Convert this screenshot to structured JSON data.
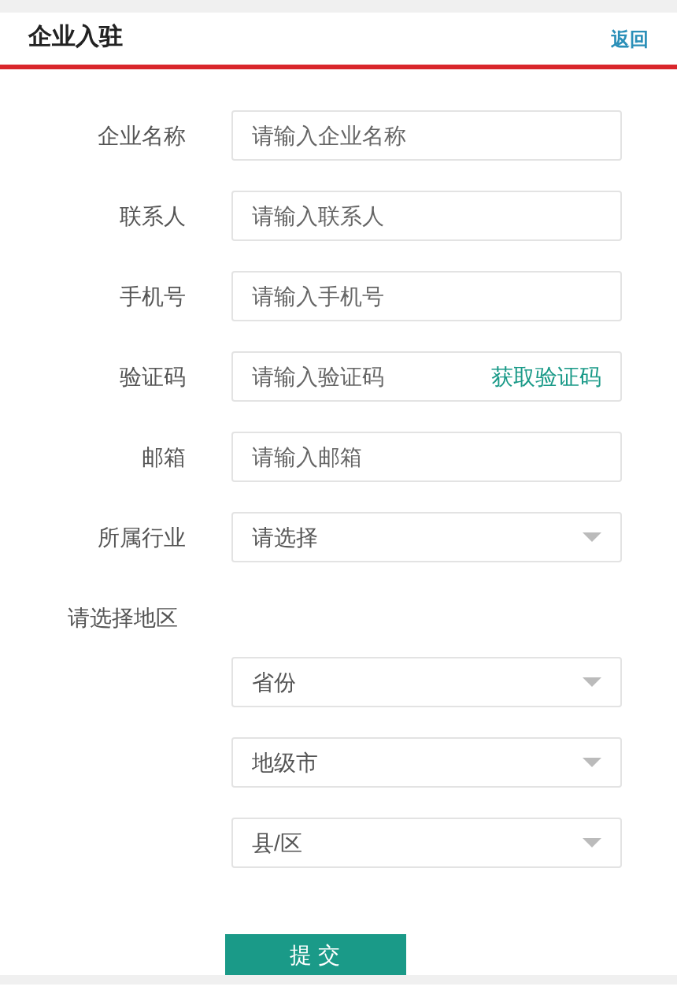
{
  "header": {
    "title": "企业入驻",
    "back_link": "返回"
  },
  "fields": [
    {
      "kind": "text",
      "label": "企业名称",
      "placeholder": "请输入企业名称"
    },
    {
      "kind": "text",
      "label": "联系人",
      "placeholder": "请输入联系人"
    },
    {
      "kind": "text",
      "label": "手机号",
      "placeholder": "请输入手机号"
    },
    {
      "kind": "code",
      "label": "验证码",
      "placeholder": "请输入验证码",
      "action": "获取验证码"
    },
    {
      "kind": "text",
      "label": "邮箱",
      "placeholder": "请输入邮箱"
    },
    {
      "kind": "select",
      "label": "所属行业",
      "placeholder": "请选择"
    }
  ],
  "region": {
    "label": "请选择地区",
    "selects": [
      {
        "placeholder": "省份"
      },
      {
        "placeholder": "地级市"
      },
      {
        "placeholder": "县/区"
      }
    ]
  },
  "submit_button": "提 交"
}
